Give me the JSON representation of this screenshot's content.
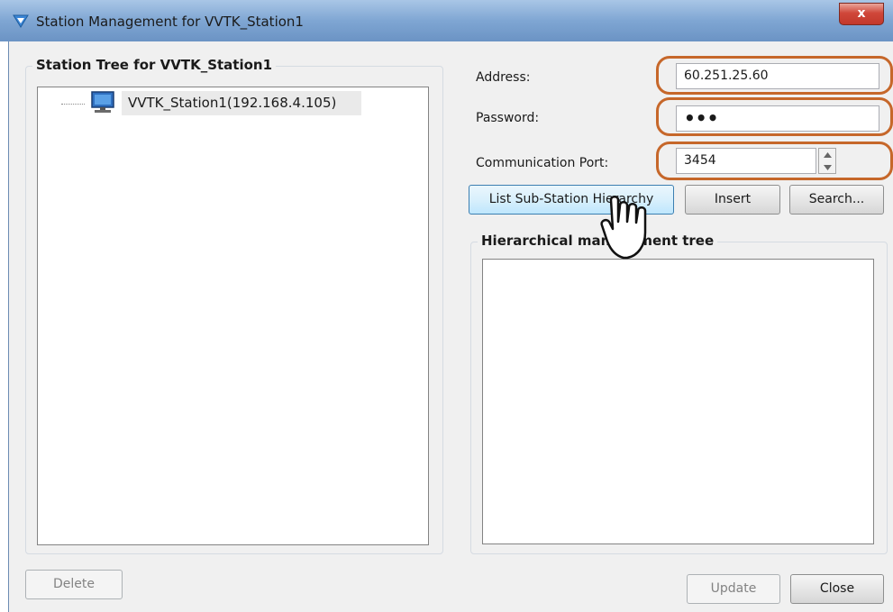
{
  "window": {
    "title": "Station Management for VVTK_Station1",
    "close_glyph": "x"
  },
  "station_tree": {
    "title": "Station Tree for VVTK_Station1",
    "node_label": "VVTK_Station1(192.168.4.105)",
    "node_icon": "monitor-icon"
  },
  "form": {
    "address_label": "Address:",
    "address_value": "60.251.25.60",
    "password_label": "Password:",
    "password_value": "•••",
    "port_label": "Communication Port:",
    "port_value": "3454"
  },
  "buttons": {
    "list_hierarchy": "List Sub-Station Hierarchy",
    "insert": "Insert",
    "search": "Search...",
    "delete": "Delete",
    "update": "Update",
    "close": "Close"
  },
  "hierarchy": {
    "title": "Hierarchical management tree"
  },
  "colors": {
    "highlight": "#c6672a",
    "titlebar": "#7fa6d3",
    "close_button": "#d0473a"
  }
}
